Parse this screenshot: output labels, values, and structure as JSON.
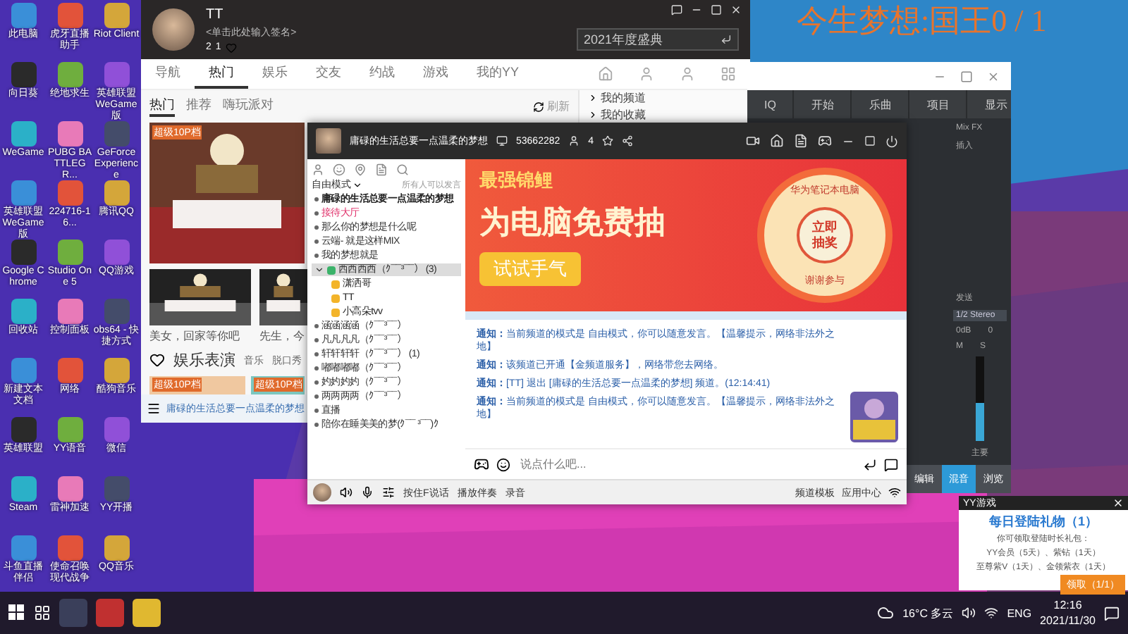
{
  "desktop_icons": [
    {
      "label": "此电脑"
    },
    {
      "label": "虎牙直播助手"
    },
    {
      "label": "Riot Client"
    },
    {
      "label": "向日葵"
    },
    {
      "label": "绝地求生"
    },
    {
      "label": "英雄联盟WeGame版"
    },
    {
      "label": "WeGame"
    },
    {
      "label": "PUBG BATTLEGR..."
    },
    {
      "label": "GeForce Experience"
    },
    {
      "label": "英雄联盟WeGame版"
    },
    {
      "label": "224716-16..."
    },
    {
      "label": "腾讯QQ"
    },
    {
      "label": "Google Chrome"
    },
    {
      "label": "Studio One 5"
    },
    {
      "label": "QQ游戏"
    },
    {
      "label": "回收站"
    },
    {
      "label": "控制面板"
    },
    {
      "label": "obs64 - 快捷方式"
    },
    {
      "label": "新建文本文档"
    },
    {
      "label": "网络"
    },
    {
      "label": "酷狗音乐"
    },
    {
      "label": "英雄联盟"
    },
    {
      "label": "YY语音"
    },
    {
      "label": "微信"
    },
    {
      "label": "Steam"
    },
    {
      "label": "雷神加速"
    },
    {
      "label": "YY开播"
    },
    {
      "label": "斗鱼直播伴侣"
    },
    {
      "label": "使命召唤现代战争"
    },
    {
      "label": "QQ音乐"
    }
  ],
  "overlay_text": "今生梦想:国王0 / 1",
  "main_window": {
    "user": {
      "name": "TT",
      "signature": "<单击此处输入签名>",
      "counts": [
        "2",
        "1"
      ]
    },
    "search": {
      "value": "2021年度盛典"
    },
    "tabs": [
      {
        "label": "导航",
        "selected": false
      },
      {
        "label": "热门",
        "selected": true
      },
      {
        "label": "娱乐",
        "selected": false
      },
      {
        "label": "交友",
        "selected": false
      },
      {
        "label": "约战",
        "selected": false
      },
      {
        "label": "游戏",
        "selected": false
      },
      {
        "label": "我的YY",
        "selected": false
      }
    ],
    "subtabs": [
      {
        "label": "热门",
        "selected": true
      },
      {
        "label": "推荐",
        "selected": false
      },
      {
        "label": "嗨玩派对",
        "selected": false
      }
    ],
    "refresh": "刷新",
    "side_items": [
      "我的频道",
      "我的收藏"
    ],
    "feature_badge": "超级10P档",
    "thumbs": [
      {
        "caption": "美女，回家等你吧"
      },
      {
        "caption": "先生，今"
      }
    ],
    "section": {
      "title": "娱乐表演",
      "tabs": [
        "音乐",
        "脱口秀"
      ]
    },
    "lower_badges": [
      "超级10P档",
      "超级10P档"
    ],
    "current_channel": "庸碌的生活总要一点温柔的梦想"
  },
  "chat_window": {
    "title": "庸碌的生活总要一点温柔的梦想",
    "channel_id": "53662282",
    "online": "4",
    "mode": "自由模式",
    "mode_note": "所有人可以发言",
    "channels": [
      {
        "name": "庸碌的生活总要一点温柔的梦想",
        "kind": "root",
        "selected": false
      },
      {
        "name": "接待大厅",
        "kind": "lobby",
        "selected": false
      },
      {
        "name": "那么你的梦想是什么呢",
        "kind": "room",
        "selected": false
      },
      {
        "name": "云端- 就是这样MIX",
        "kind": "room",
        "selected": false
      },
      {
        "name": "我的梦想就是",
        "kind": "room",
        "selected": false
      },
      {
        "name": "西西西西（ｸ¯¯³¯¯）",
        "count": "(3)",
        "kind": "room",
        "selected": true,
        "expanded": true,
        "children": [
          {
            "name": "潇洒哥"
          },
          {
            "name": "TT"
          },
          {
            "name": "小高朵tvv"
          }
        ]
      },
      {
        "name": "涵涵涵涵（ｸ¯¯³¯¯）",
        "kind": "room",
        "selected": false
      },
      {
        "name": "凡凡凡凡（ｸ¯¯³¯¯）",
        "kind": "room",
        "selected": false
      },
      {
        "name": "轩轩轩轩（ｸ¯¯³¯¯）",
        "count": "(1)",
        "kind": "room",
        "selected": false
      },
      {
        "name": "嘟嘟嘟嘟（ｸ¯¯³¯¯）",
        "kind": "room",
        "selected": false
      },
      {
        "name": "妁妁妁妁（ｸ¯¯³¯¯）",
        "kind": "room",
        "selected": false
      },
      {
        "name": "两两两两（ｸ¯¯³¯¯）",
        "kind": "room",
        "selected": false
      },
      {
        "name": "直播",
        "kind": "room",
        "selected": false
      },
      {
        "name": "陪你在睡美美的梦(ｸ¯¯ ³¯¯)ｸ",
        "kind": "room",
        "selected": false
      }
    ],
    "banner": {
      "headline": "最强锦鲤",
      "title": "为电脑免费抽",
      "button": "试试手气",
      "wheel_top": "华为笔记本电脑",
      "wheel_center": "立即抽奖",
      "wheel_bottom": "谢谢参与"
    },
    "messages": [
      {
        "label": "通知：",
        "text": "当前频道的模式是 自由模式，你可以随意发言。【温馨提示，网络非法外之地】"
      },
      {
        "label": "通知：",
        "text": "该频道已开通【金频道服务】，网络带您去网络。"
      },
      {
        "label": "通知：",
        "text": "[TT] 退出 [庸碌的生活总要一点温柔的梦想] 频道。(12:14:41)"
      },
      {
        "label": "通知：",
        "text": "当前频道的模式是 自由模式，你可以随意发言。【温馨提示，网络非法外之地】"
      }
    ],
    "input": {
      "placeholder": "说点什么吧..."
    },
    "bottom_left": [
      "按住F说话",
      "播放伴奏",
      "录音"
    ],
    "bottom_right": [
      "频道模板",
      "应用中心"
    ]
  },
  "daw": {
    "iq": "IQ",
    "toolbar": [
      "开始",
      "乐曲",
      "项目",
      "显示"
    ],
    "mixfx": "Mix FX",
    "insert": "插入",
    "send": "发送",
    "stereo": "1/2 Stereo",
    "gain": "0dB",
    "pan": "0",
    "mute": "M",
    "solo": "S",
    "channel": "主要",
    "level": 0.45,
    "tabs": [
      {
        "label": "编辑",
        "selected": false
      },
      {
        "label": "混音",
        "selected": true
      },
      {
        "label": "浏览",
        "selected": false
      }
    ]
  },
  "popup": {
    "app": "YY游戏",
    "title": "每日登陆礼物（1）",
    "lines": [
      "你可领取登陆时长礼包：",
      "YY会员（5天）、紫钻（1天）",
      "至尊紫V（1天）、金领紫衣（1天）"
    ],
    "button": "领取（1/1）"
  },
  "taskbar": {
    "weather": "16°C 多云",
    "lang": "ENG",
    "time": "12:16",
    "date": "2021/11/30"
  }
}
